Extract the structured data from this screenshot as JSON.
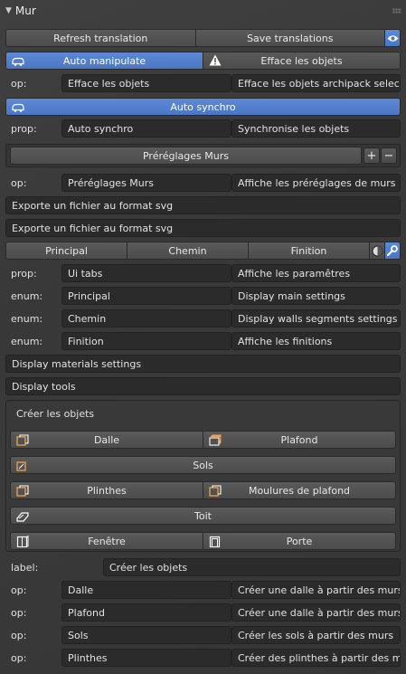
{
  "panel": {
    "title": "Mur"
  },
  "toolbar": {
    "refresh": "Refresh translation",
    "save": "Save translations",
    "auto_manipulate": "Auto manipulate",
    "efface": "Efface les objets",
    "auto_synchro": "Auto synchro"
  },
  "rows": {
    "op1": {
      "label": "op:",
      "name": "Efface les objets",
      "desc": "Efface les objets archipack selecti..."
    },
    "prop1": {
      "label": "prop:",
      "name": "Auto synchro",
      "desc": "Synchronise les objets"
    },
    "presets_button": "Préréglages Murs",
    "presets_add": "+",
    "presets_remove": "−",
    "op2": {
      "label": "op:",
      "name": "Préréglages Murs",
      "desc": "Affiche les préréglages de murs"
    },
    "export1": "Exporte un fichier au format svg",
    "export2": "Exporte un fichier au format svg"
  },
  "tabs": [
    "Principal",
    "Chemin",
    "Finition"
  ],
  "props": [
    {
      "label": "prop:",
      "name": "Ui tabs",
      "desc": "Affiche les paramêtres"
    },
    {
      "label": "enum:",
      "name": "Principal",
      "desc": "Display main settings"
    },
    {
      "label": "enum:",
      "name": "Chemin",
      "desc": "Display walls segments settings"
    },
    {
      "label": "enum:",
      "name": "Finition",
      "desc": "Affiche les finitions"
    }
  ],
  "info": {
    "materials": "Display materials settings",
    "tools": "Display tools"
  },
  "create": {
    "title": "Créer les objets",
    "dalle": "Dalle",
    "plafond": "Plafond",
    "sols": "Sols",
    "plinthes": "Plinthes",
    "moulures": "Moulures de plafond",
    "toit": "Toit",
    "fenetre": "Fenêtre",
    "porte": "Porte"
  },
  "bottom": {
    "label_row": {
      "label": "label:",
      "name": "Créer les objets"
    },
    "ops": [
      {
        "label": "op:",
        "name": "Dalle",
        "desc": "Créer une dalle à partir des murs"
      },
      {
        "label": "op:",
        "name": "Plafond",
        "desc": "Créer une dalle à partir des murs"
      },
      {
        "label": "op:",
        "name": "Sols",
        "desc": "Créer les sols à partir des murs"
      },
      {
        "label": "op:",
        "name": "Plinthes",
        "desc": "Créer des plinthes à partir des murs"
      }
    ]
  },
  "colors": {
    "accent": "#5680c9",
    "warning": "#ffffff",
    "background": "#3d3d3d",
    "field": "#2b2b2b"
  }
}
